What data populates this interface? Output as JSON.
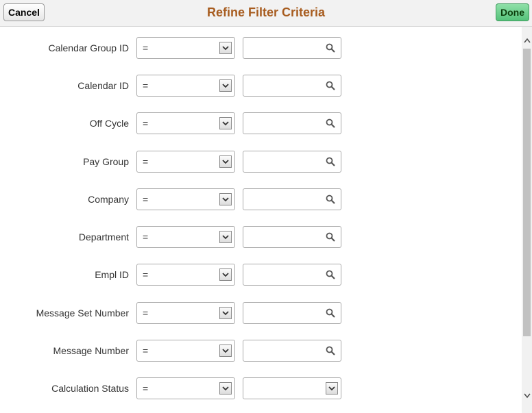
{
  "header": {
    "cancel_label": "Cancel",
    "title": "Refine Filter Criteria",
    "done_label": "Done"
  },
  "rows": [
    {
      "label": "Calendar Group ID",
      "operator": "=",
      "value": "",
      "value_control": "prompt"
    },
    {
      "label": "Calendar ID",
      "operator": "=",
      "value": "",
      "value_control": "prompt"
    },
    {
      "label": "Off Cycle",
      "operator": "=",
      "value": "",
      "value_control": "prompt"
    },
    {
      "label": "Pay Group",
      "operator": "=",
      "value": "",
      "value_control": "prompt"
    },
    {
      "label": "Company",
      "operator": "=",
      "value": "",
      "value_control": "prompt"
    },
    {
      "label": "Department",
      "operator": "=",
      "value": "",
      "value_control": "prompt"
    },
    {
      "label": "Empl ID",
      "operator": "=",
      "value": "",
      "value_control": "prompt"
    },
    {
      "label": "Message Set Number",
      "operator": "=",
      "value": "",
      "value_control": "prompt"
    },
    {
      "label": "Message Number",
      "operator": "=",
      "value": "",
      "value_control": "prompt"
    },
    {
      "label": "Calculation Status",
      "operator": "=",
      "value": "",
      "value_control": "dropdown"
    }
  ],
  "icons": {
    "prompt": "search-icon",
    "dropdown": "chevron-down-icon",
    "scroll_up": "scroll-up-arrow-icon",
    "scroll_down": "scroll-down-arrow-icon"
  },
  "colors": {
    "title": "#a75c1f",
    "done_button": "#55c27a",
    "cancel_button": "#e6e6e6"
  }
}
